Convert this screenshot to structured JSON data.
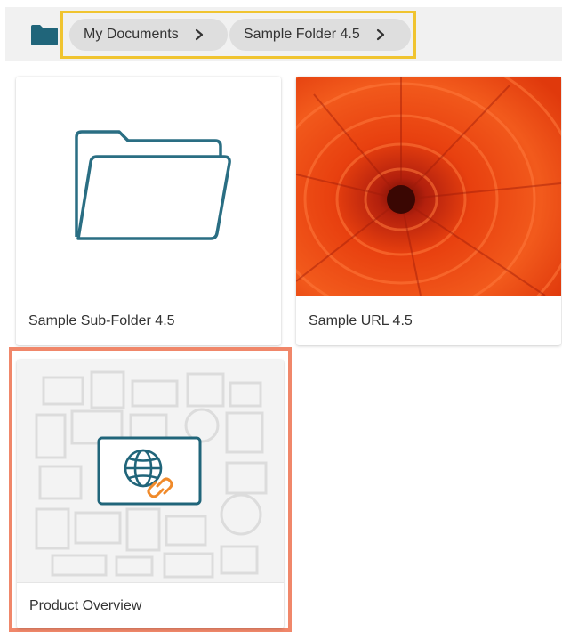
{
  "breadcrumb": {
    "items": [
      {
        "label": "My Documents"
      },
      {
        "label": "Sample Folder 4.5"
      }
    ]
  },
  "tiles": [
    {
      "title": "Sample Sub-Folder 4.5",
      "type": "folder"
    },
    {
      "title": "Sample URL 4.5",
      "type": "url-image"
    },
    {
      "title": "Product Overview",
      "type": "url-link"
    }
  ],
  "icons": {
    "home": "folder-icon",
    "separator": "chevron-right-icon",
    "folder_tile": "open-folder-icon",
    "link_tile": "globe-link-icon"
  },
  "colors": {
    "breadcrumb_highlight": "#f0c430",
    "selected_tile_highlight": "#f0876a",
    "folder_stroke": "#2a6e83",
    "folder_icon": "#20657a",
    "link_orange": "#f08a2a"
  }
}
